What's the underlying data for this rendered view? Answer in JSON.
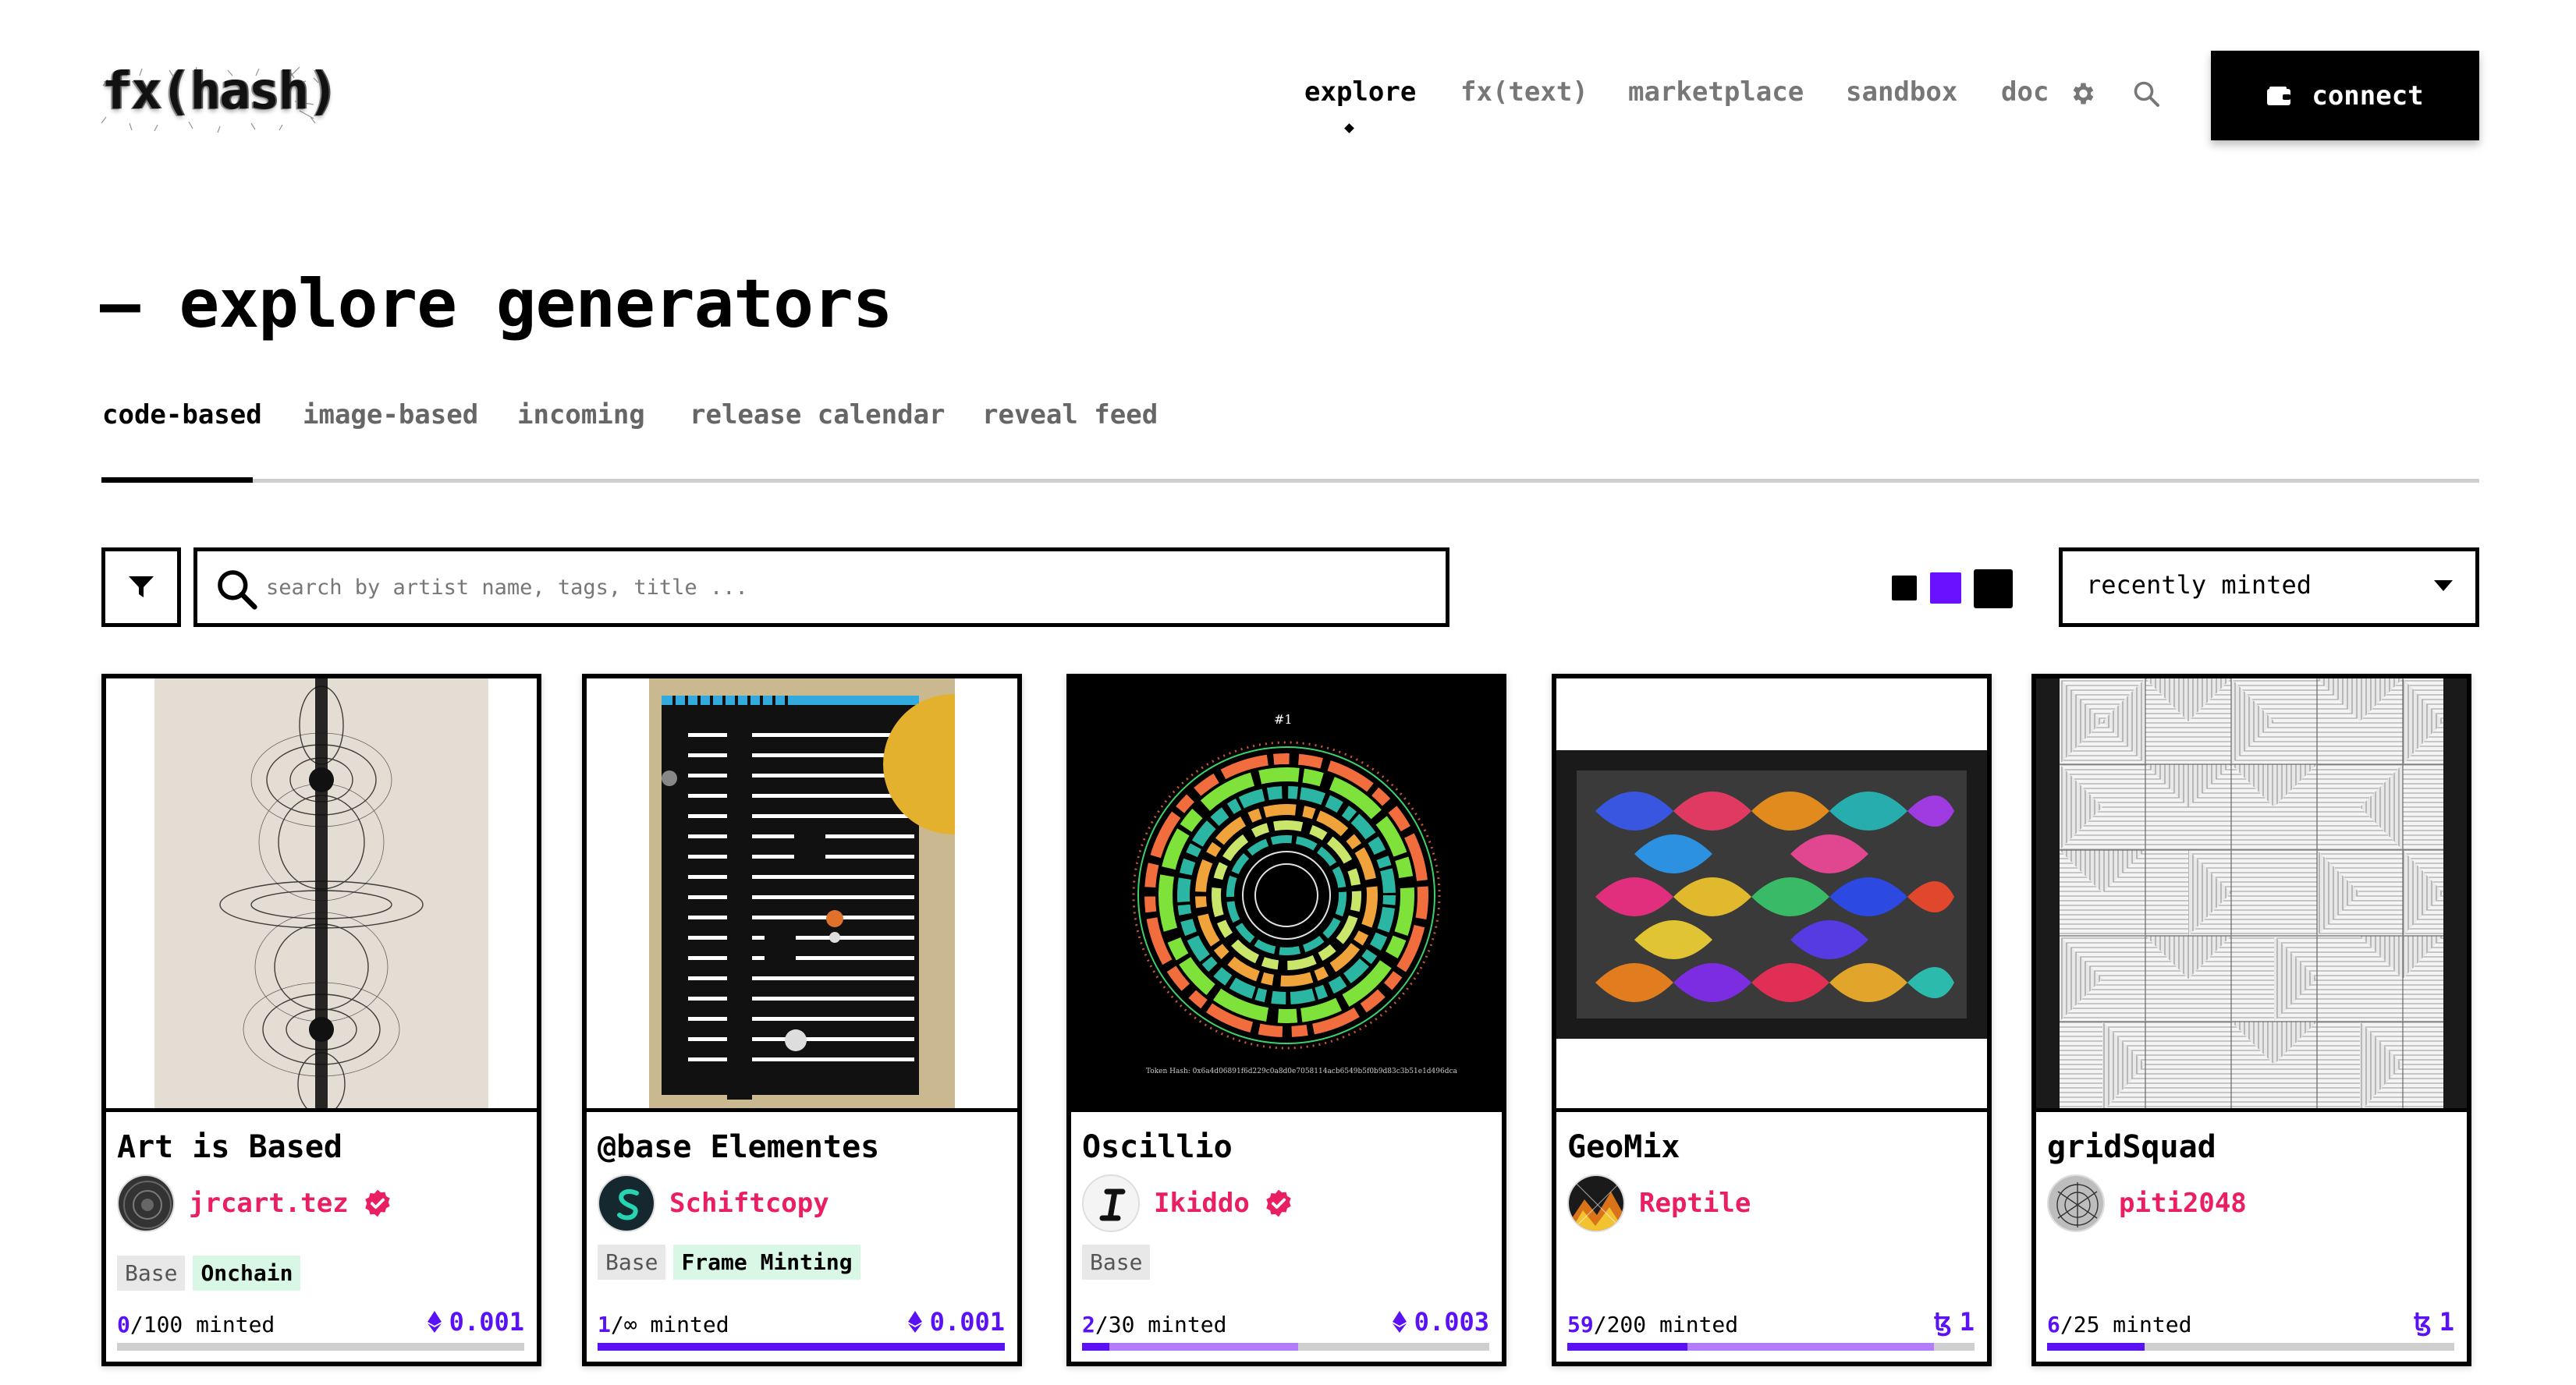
{
  "header": {
    "logo_text": "fx(hash)",
    "nav": [
      "explore",
      "fx(text)",
      "marketplace",
      "sandbox",
      "doc"
    ],
    "active_nav": "explore",
    "icons": [
      "gear-icon",
      "search-icon"
    ],
    "connect_label": "connect"
  },
  "page": {
    "title": "— explore generators",
    "tabs": [
      "code-based",
      "image-based",
      "incoming",
      "release calendar",
      "reveal feed"
    ],
    "active_tab": "code-based"
  },
  "filters": {
    "search_placeholder": "search by artist name, tags, title ...",
    "sort_value": "recently minted",
    "size_options": [
      "small",
      "medium",
      "large"
    ],
    "selected_size": "medium"
  },
  "colors": {
    "accent": "#5a12f5",
    "artist": "#e91e63",
    "tag_green": "#d8f7e4"
  },
  "cards": [
    {
      "title": "Art is Based",
      "artist": "jrcart.tez",
      "verified": true,
      "tags": [
        "Base",
        "Onchain"
      ],
      "minted_count": "0",
      "minted_total": "/100 minted",
      "price_currency": "eth",
      "price": "0.001",
      "progress": 0,
      "reserved": 0
    },
    {
      "title": "@base Elementes",
      "artist": "Schiftcopy",
      "verified": false,
      "tags": [
        "Base",
        "Frame Minting"
      ],
      "minted_count": "1",
      "minted_total": "/∞ minted",
      "price_currency": "eth",
      "price": "0.001",
      "progress": 1.0,
      "reserved": 1.0
    },
    {
      "title": "Oscillio",
      "artist": "Ikiddo",
      "verified": true,
      "tags": [
        "Base"
      ],
      "minted_count": "2",
      "minted_total": "/30 minted",
      "price_currency": "eth",
      "price": "0.003",
      "progress": 0.067,
      "reserved": 0.53
    },
    {
      "title": "GeoMix",
      "artist": "Reptile",
      "verified": false,
      "tags": [],
      "minted_count": "59",
      "minted_total": "/200 minted",
      "price_currency": "tez",
      "price": "1",
      "progress": 0.295,
      "reserved": 0.9
    },
    {
      "title": "gridSquad",
      "artist": "piti2048",
      "verified": false,
      "tags": [],
      "minted_count": "6",
      "minted_total": "/25 minted",
      "price_currency": "tez",
      "price": "1",
      "progress": 0.24,
      "reserved": 0
    }
  ]
}
